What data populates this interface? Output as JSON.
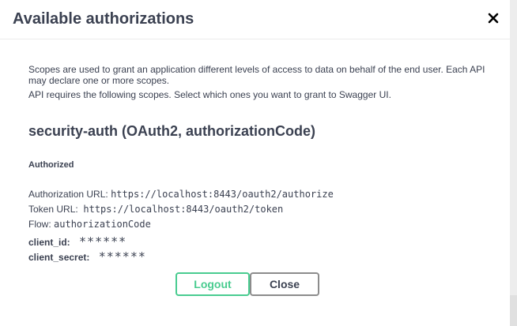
{
  "modal": {
    "title": "Available authorizations",
    "close_icon": "close-icon"
  },
  "description": {
    "line1": "Scopes are used to grant an application different levels of access to data on behalf of the end user. Each API may declare one or more scopes.",
    "line2": "API requires the following scopes. Select which ones you want to grant to Swagger UI."
  },
  "scheme": {
    "title": "security-auth (OAuth2, authorizationCode)",
    "status": "Authorized",
    "authorization_url_label": "Authorization URL:",
    "authorization_url": "https://localhost:8443/oauth2/authorize",
    "token_url_label": "Token URL:",
    "token_url": "https://localhost:8443/oauth2/token",
    "flow_label": "Flow:",
    "flow": "authorizationCode",
    "client_id_label": "client_id:",
    "client_id_value": "******",
    "client_secret_label": "client_secret:",
    "client_secret_value": "******"
  },
  "buttons": {
    "logout_label": "Logout",
    "close_label": "Close"
  },
  "colors": {
    "text": "#3b4151",
    "logout_accent": "#49cc90",
    "close_border": "#8c8c8c"
  }
}
